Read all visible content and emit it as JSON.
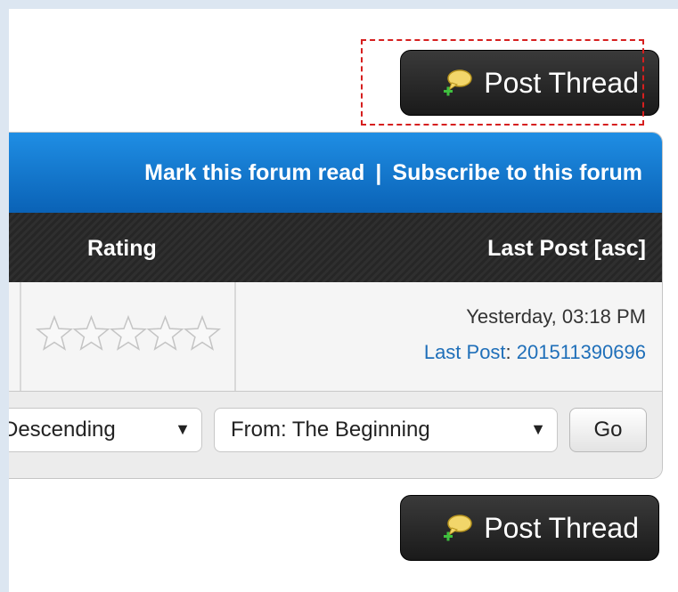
{
  "post_thread_top": {
    "label": "Post Thread"
  },
  "forum_actions": {
    "mark_read": "Mark this forum read",
    "separator": "|",
    "subscribe": "Subscribe to this forum"
  },
  "columns": {
    "rating": "Rating",
    "last_post": "Last Post [asc]"
  },
  "thread_row": {
    "rating_stars": 5,
    "rating_value": 0,
    "last_post_date": "Yesterday, 03:18 PM",
    "last_post_label": "Last Post",
    "last_post_colon": ":",
    "last_post_user": "201511390696"
  },
  "sort_controls": {
    "order_value": "Descending",
    "from_value": "From: The Beginning",
    "arrow": "▼",
    "go_label": "Go"
  },
  "post_thread_bottom": {
    "label": "Post Thread"
  },
  "colors": {
    "accent_blue": "#0a62b6",
    "link_blue": "#1f6fb9",
    "focus_red": "#d61f1f"
  }
}
